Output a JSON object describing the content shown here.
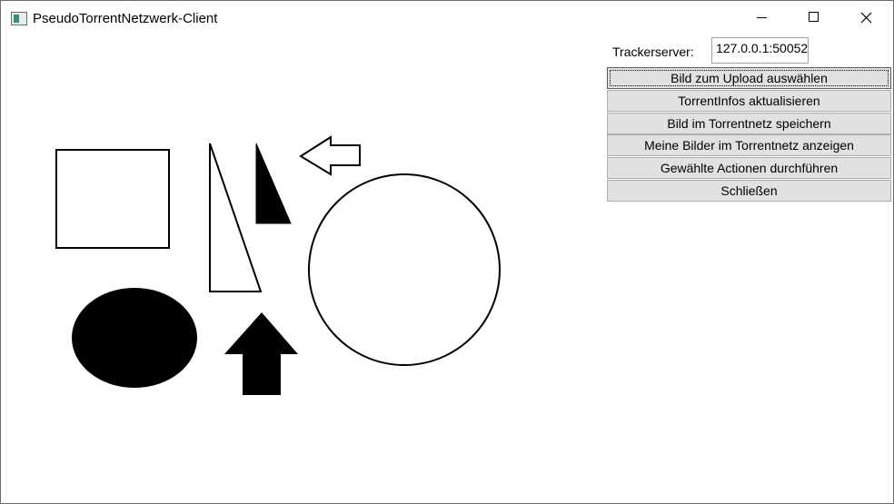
{
  "window": {
    "title": "PseudoTorrentNetzwerk-Client",
    "app_icon": "app-window-icon",
    "controls": {
      "minimize": "minimize-icon",
      "maximize": "maximize-icon",
      "close": "close-icon"
    }
  },
  "tracker": {
    "label": "Trackerserver:",
    "value": "127.0.0.1:50052"
  },
  "buttons": {
    "upload": "Bild zum Upload auswählen",
    "refresh": "TorrentInfos aktualisieren",
    "save": "Bild im Torrentnetz speichern",
    "show": "Meine Bilder im Torrentnetz anzeigen",
    "execute": "Gewählte Actionen durchführen",
    "close": "Schließen"
  },
  "colors": {
    "button_face": "#e1e1e1",
    "button_border": "#adadad",
    "shape_stroke": "#000000",
    "shape_fill": "#000000"
  }
}
